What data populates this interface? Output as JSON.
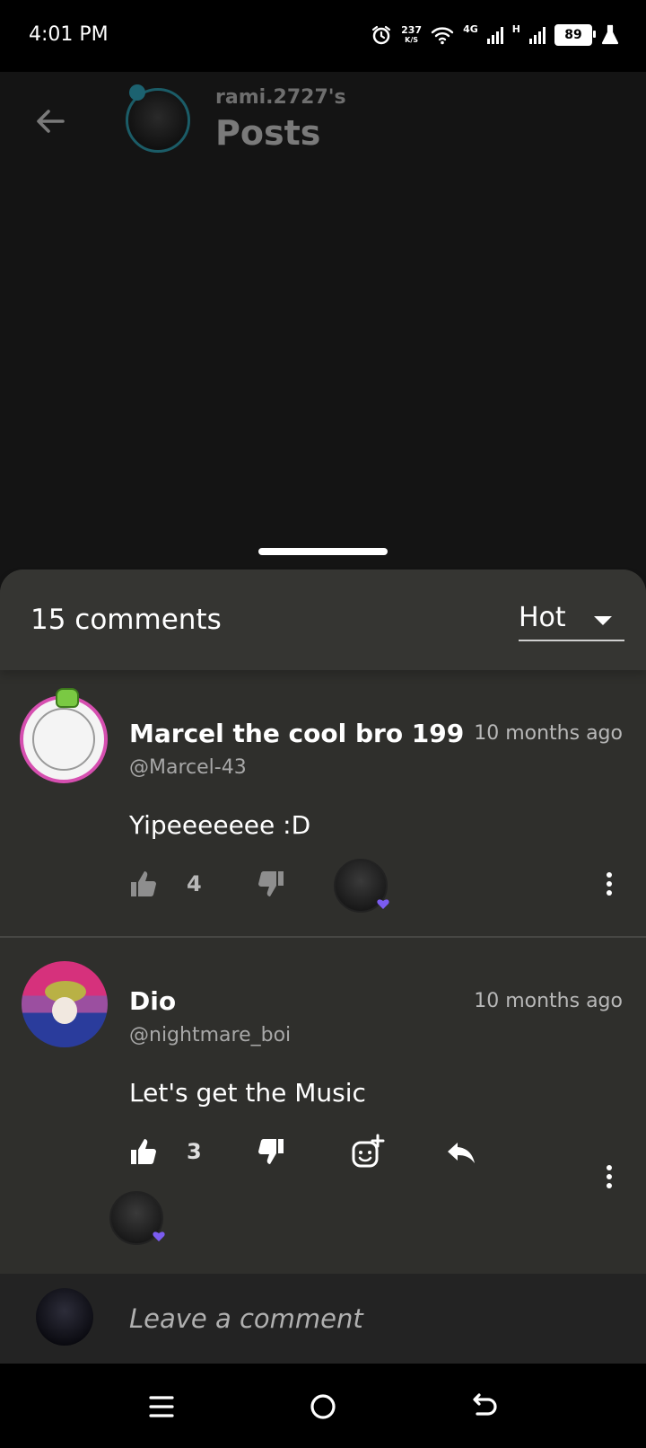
{
  "status_bar": {
    "time": "4:01 PM",
    "net_speed_value": "237",
    "net_speed_unit": "K/S",
    "network_4g": "4G",
    "network_h": "H",
    "battery": "89"
  },
  "header": {
    "subtitle": "rami.2727's",
    "title": "Posts"
  },
  "comments_panel": {
    "count_label": "15 comments",
    "sort_selected": "Hot",
    "comments": [
      {
        "name": "Marcel the cool bro 199",
        "handle": "@Marcel-43",
        "time": "10 months ago",
        "text": "Yipeeeeeee :D",
        "likes": "4"
      },
      {
        "name": "Dio",
        "handle": "@nightmare_boi",
        "time": "10 months ago",
        "text": "Let's get the Music",
        "likes": "3"
      }
    ]
  },
  "compose": {
    "placeholder": "Leave a comment"
  },
  "colors": {
    "sheet_background": "#2f2f2c",
    "heart_badge": "#7b5cf0",
    "avatar_ring_pink": "#d64fb0"
  }
}
